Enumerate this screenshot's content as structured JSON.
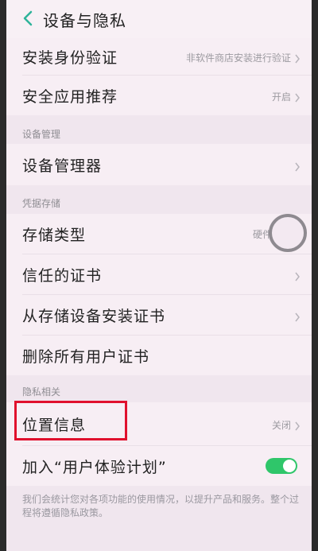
{
  "header": {
    "title": "设备与隐私"
  },
  "rows": {
    "install_verification": {
      "label": "安装身份验证",
      "value": "非软件商店安装进行验证"
    },
    "security_app_recommend": {
      "label": "安全应用推荐",
      "value": "开启"
    },
    "device_admin": {
      "label": "设备管理器"
    },
    "storage_type": {
      "label": "存储类型",
      "value": "硬件"
    },
    "trusted_certs": {
      "label": "信任的证书"
    },
    "install_from_storage": {
      "label": "从存储设备安装证书"
    },
    "delete_user_certs": {
      "label": "删除所有用户证书"
    },
    "location_info": {
      "label": "位置信息",
      "value": "关闭"
    },
    "ux_program": {
      "label": "加入“用户体验计划”",
      "enabled": true
    }
  },
  "sections": {
    "device_management": "设备管理",
    "credential_storage": "凭据存储",
    "privacy": "隐私相关"
  },
  "footer": {
    "note": "我们会统计您对各项功能的使用情况，以提升产品和服务。整个过程将遵循隐私政策。"
  },
  "colors": {
    "toggle_on": "#2fc66a",
    "highlight": "#e0102d",
    "back_icon": "#2fb39a"
  },
  "icons": {
    "back": "chevron-left-icon",
    "row_arrow": "chevron-right-icon"
  }
}
